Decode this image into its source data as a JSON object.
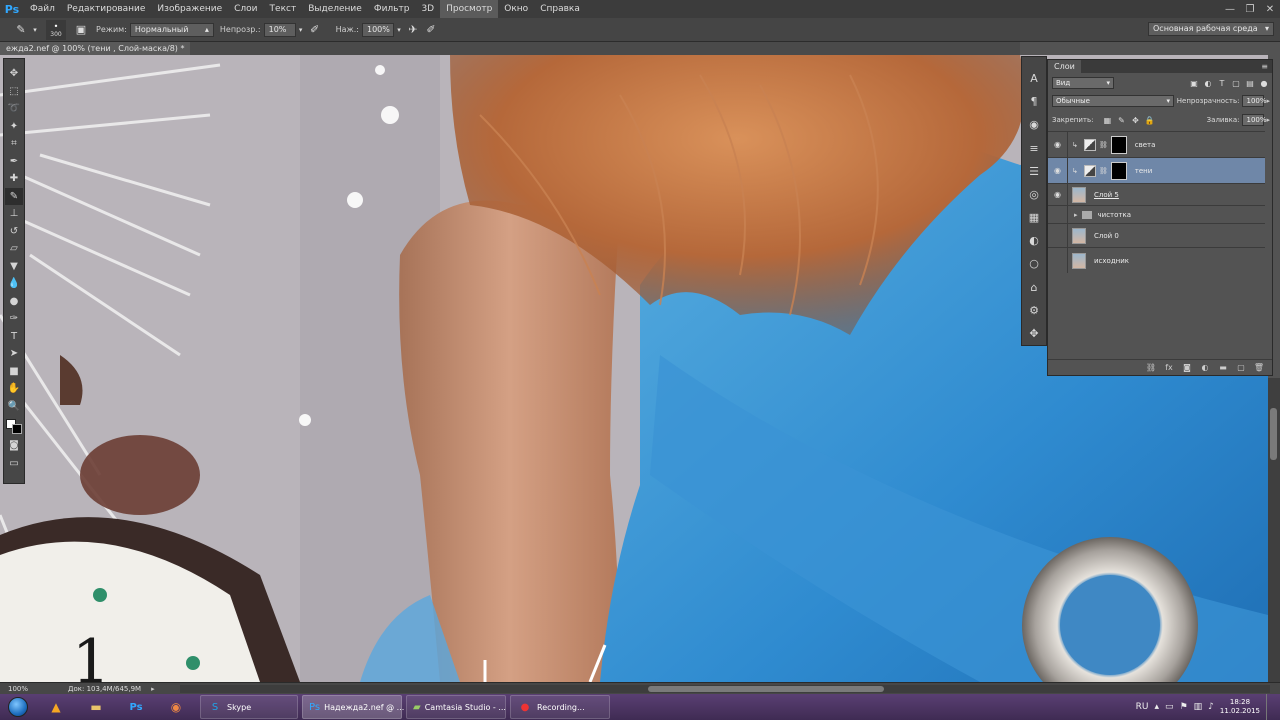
{
  "app": {
    "logo": "Ps",
    "menu": [
      "Файл",
      "Редактирование",
      "Изображение",
      "Слои",
      "Текст",
      "Выделение",
      "Фильтр",
      "3D",
      "Просмотр",
      "Окно",
      "Справка"
    ],
    "active_menu": "Просмотр",
    "window_controls": [
      "—",
      "❐",
      "✕"
    ]
  },
  "options": {
    "brush_size": "300",
    "mode_label": "Режим:",
    "mode_value": "Нормальный",
    "opacity_label": "Непрозр.:",
    "opacity_value": "10%",
    "flow_label": "Наж.:",
    "flow_value": "100%",
    "workspace": "Основная рабочая среда"
  },
  "document": {
    "tab_title": "ежда2.nef @ 100% (тени , Слой-маска/8) *",
    "zoom": "100%",
    "doc_size": "Док: 103,4M/645,9M"
  },
  "layers_panel": {
    "tab": "Слои",
    "filter_kind": "Вид",
    "blend_mode": "Обычные",
    "opacity_label": "Непрозрачность:",
    "opacity_value": "100%",
    "lock_label": "Закрепить:",
    "fill_label": "Заливка:",
    "fill_value": "100%",
    "layers": [
      {
        "name": "света",
        "visible": true,
        "kind": "adjust"
      },
      {
        "name": "тени",
        "visible": true,
        "kind": "adjust",
        "selected": true
      },
      {
        "name": "Слой 5",
        "visible": true,
        "kind": "pixel"
      },
      {
        "name": "чистотка",
        "visible": false,
        "kind": "group"
      },
      {
        "name": "Слой 0",
        "visible": false,
        "kind": "pixel"
      },
      {
        "name": "исходник",
        "visible": false,
        "kind": "pixel"
      }
    ]
  },
  "taskbar": {
    "tasks": [
      {
        "label": "Skype",
        "icon": "skype-icon"
      },
      {
        "label": "Надежда2.nef @ ...",
        "icon": "photoshop-icon",
        "active": true
      },
      {
        "label": "Camtasia Studio - ...",
        "icon": "camtasia-icon"
      },
      {
        "label": "Recording...",
        "icon": "recording-icon"
      }
    ],
    "lang": "RU",
    "time": "18:28",
    "date": "11.02.2015"
  },
  "colors": {
    "selection": "#6f87a8",
    "ps_blue": "#31a8ff"
  }
}
